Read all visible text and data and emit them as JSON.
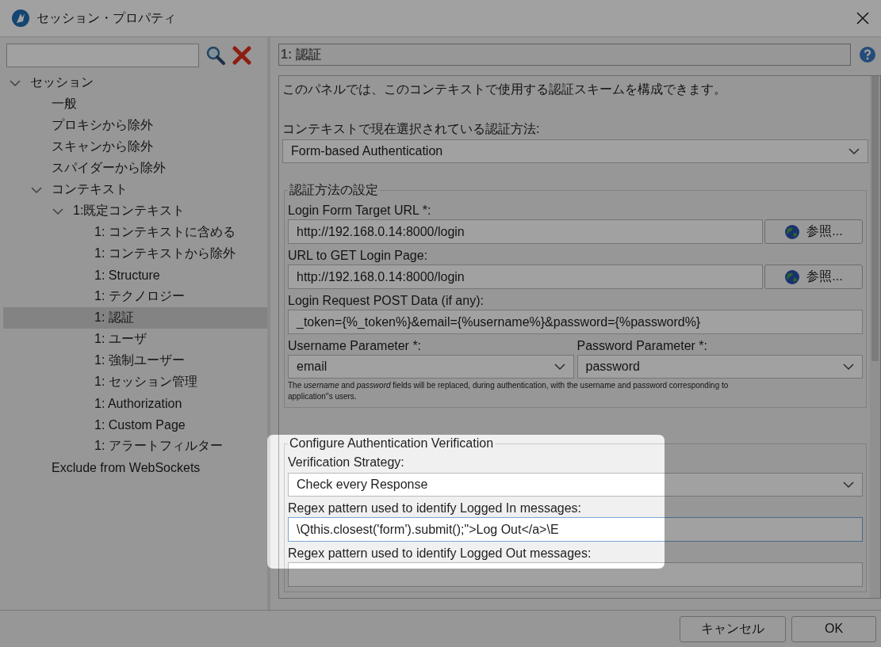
{
  "window": {
    "title": "セッション・プロパティ"
  },
  "sidebar": {
    "tree": [
      {
        "label": "セッション",
        "expanded": true,
        "selected": false,
        "children": [
          {
            "label": "一般",
            "selected": false
          },
          {
            "label": "プロキシから除外",
            "selected": false
          },
          {
            "label": "スキャンから除外",
            "selected": false
          },
          {
            "label": "スパイダーから除外",
            "selected": false
          },
          {
            "label": "コンテキスト",
            "expanded": true,
            "selected": false,
            "children": [
              {
                "label": "1:既定コンテキスト",
                "expanded": true,
                "selected": false,
                "children": [
                  {
                    "label": "1: コンテキストに含める",
                    "selected": false
                  },
                  {
                    "label": "1: コンテキストから除外",
                    "selected": false
                  },
                  {
                    "label": "1: Structure",
                    "selected": false
                  },
                  {
                    "label": "1: テクノロジー",
                    "selected": false
                  },
                  {
                    "label": "1: 認証",
                    "selected": true
                  },
                  {
                    "label": "1: ユーザ",
                    "selected": false
                  },
                  {
                    "label": "1: 強制ユーザー",
                    "selected": false
                  },
                  {
                    "label": "1: セッション管理",
                    "selected": false
                  },
                  {
                    "label": "1: Authorization",
                    "selected": false
                  },
                  {
                    "label": "1: Custom Page",
                    "selected": false
                  },
                  {
                    "label": "1: アラートフィルター",
                    "selected": false
                  }
                ]
              }
            ]
          },
          {
            "label": "Exclude from WebSockets",
            "selected": false
          }
        ]
      }
    ]
  },
  "panel": {
    "title": "1: 認証",
    "description": "このパネルでは、このコンテキストで使用する認証スキームを構成できます。",
    "method_label": "コンテキストで現在選択されている認証方法:",
    "method_value": "Form-based Authentication",
    "settings": {
      "title": "認証方法の設定",
      "login_form_target_url": {
        "label": "Login Form Target URL *:",
        "value": "http://192.168.0.14:8000/login",
        "button": "参照..."
      },
      "login_page_url": {
        "label": "URL to GET Login Page:",
        "value": "http://192.168.0.14:8000/login",
        "button": "参照..."
      },
      "post_data": {
        "label": "Login Request POST Data (if any):",
        "value": "_token={%_token%}&email={%username%}&password={%password%}"
      },
      "username_parameter": {
        "label": "Username Parameter *:",
        "value": "email"
      },
      "password_parameter": {
        "label": "Password Parameter *:",
        "value": "password"
      },
      "note": "The *username* and *password* fields will be replaced, during authentication, with the username and password corresponding to application''s users."
    },
    "verification": {
      "title": "Configure Authentication Verification",
      "strategy_label": "Verification Strategy:",
      "strategy_value": "Check every Response",
      "logged_in_label": "Regex pattern used to identify Logged In messages:",
      "logged_in_value": "\\Qthis.closest('form').submit();\">Log Out</a>\\E",
      "logged_out_label": "Regex pattern used to identify Logged Out messages:"
    }
  },
  "buttons": [
    {
      "label": "キャンセル"
    },
    {
      "label": "OK"
    }
  ]
}
